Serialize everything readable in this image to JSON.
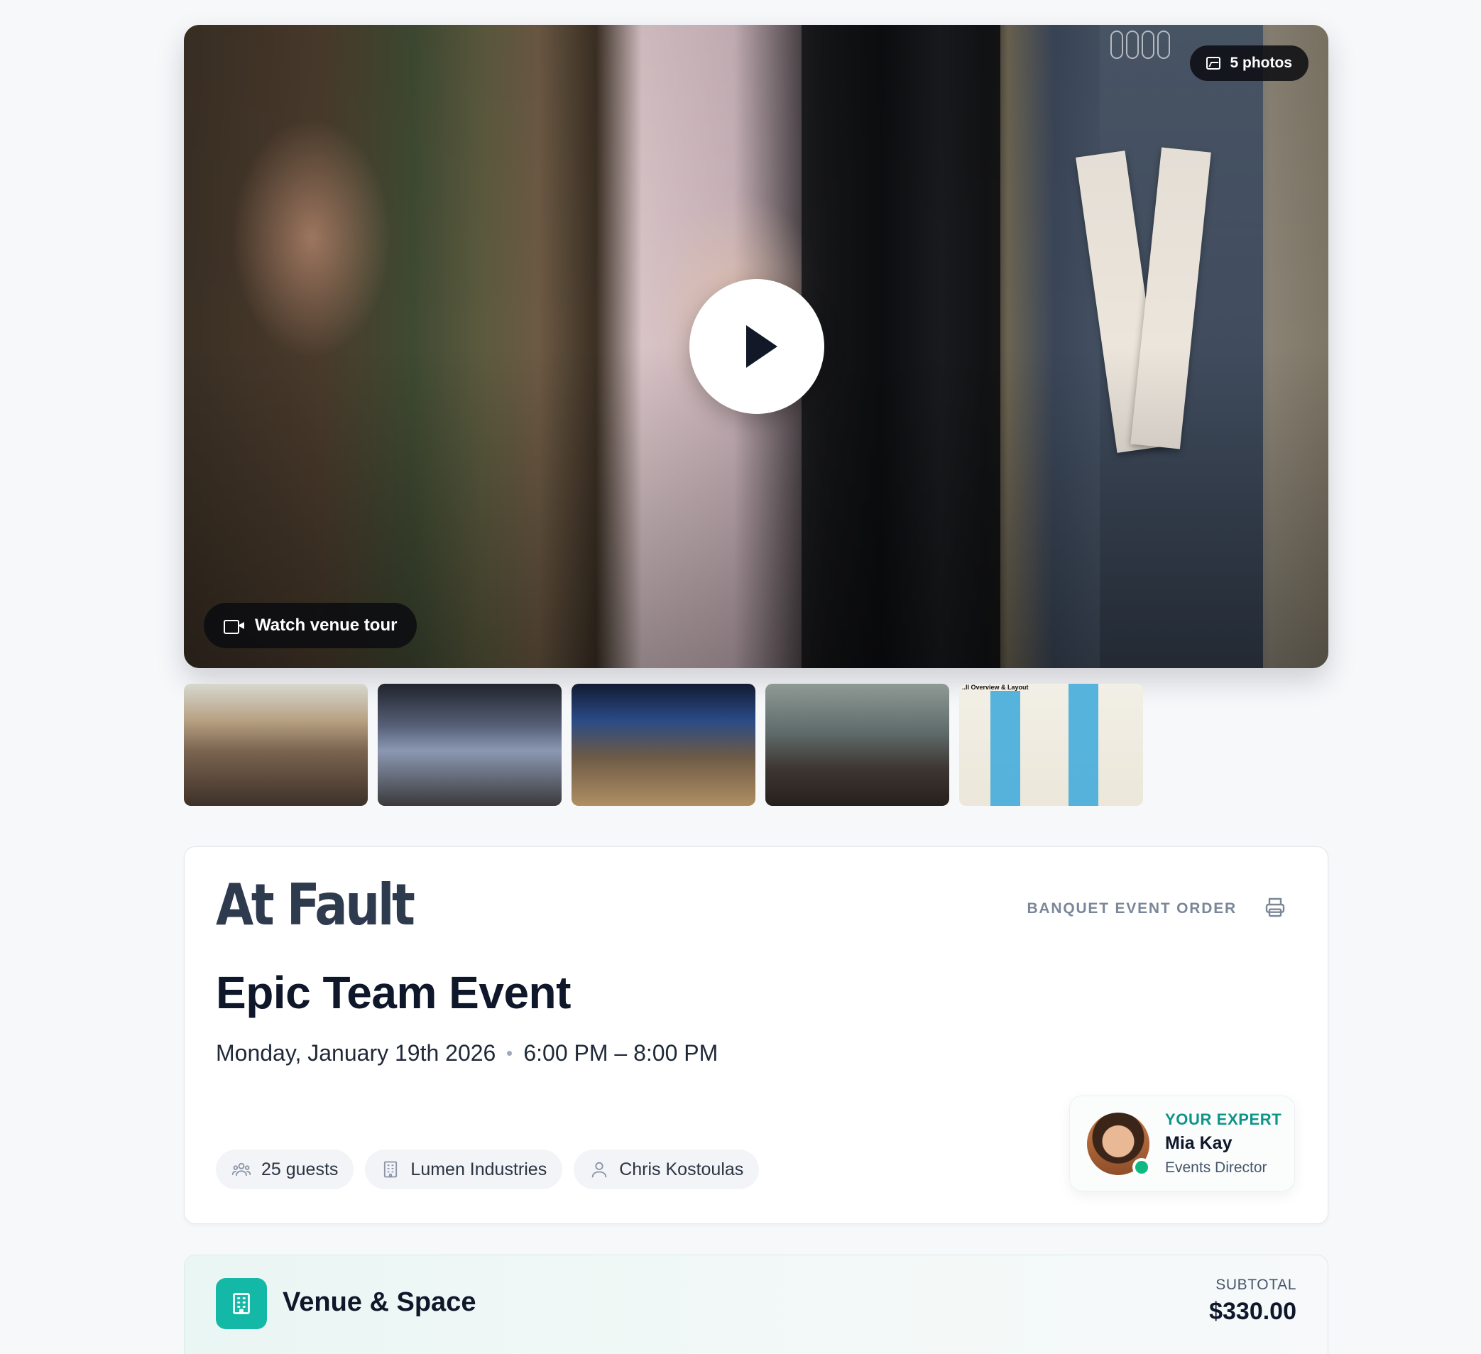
{
  "hero": {
    "photos_label": "5 photos",
    "tour_label": "Watch venue tour",
    "icons": {
      "photos": "image-icon",
      "tour": "video-camera-icon",
      "play": "play-icon"
    }
  },
  "thumbnails": [
    {
      "name": "thumbnail-1"
    },
    {
      "name": "thumbnail-2"
    },
    {
      "name": "thumbnail-3"
    },
    {
      "name": "thumbnail-4"
    },
    {
      "name": "thumbnail-5-floorplan",
      "label": "..ll Overview & Layout"
    }
  ],
  "event": {
    "brand": "At Fault",
    "document_label": "BANQUET EVENT ORDER",
    "title": "Epic Team Event",
    "date": "Monday, January 19th 2026",
    "time": "6:00 PM – 8:00 PM",
    "chips": {
      "guests": "25 guests",
      "company": "Lumen Industries",
      "contact": "Chris Kostoulas"
    }
  },
  "expert": {
    "kicker": "YOUR EXPERT",
    "name": "Mia Kay",
    "role": "Events Director",
    "status_color": "#10b981"
  },
  "section": {
    "title": "Venue & Space",
    "subtotal_label": "SUBTOTAL",
    "subtotal_value": "$330.00",
    "accent": "#14b8a6"
  }
}
